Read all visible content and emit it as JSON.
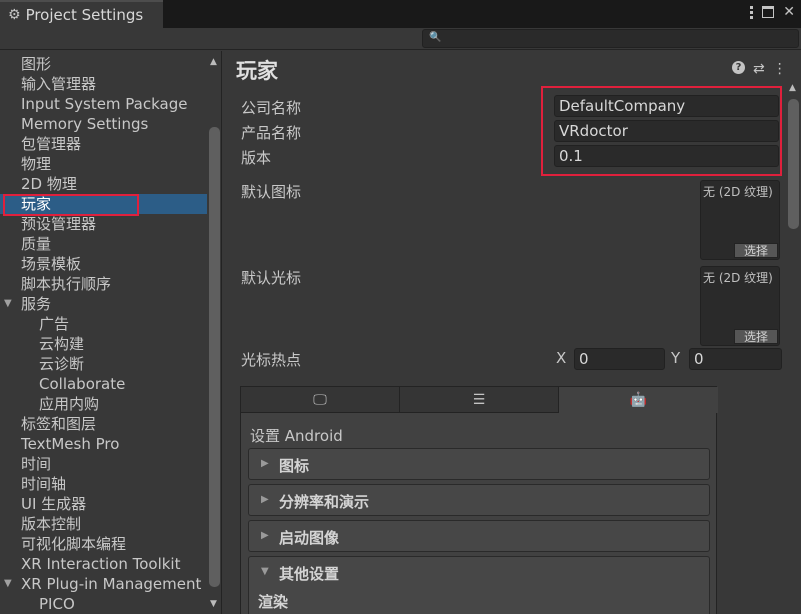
{
  "window": {
    "title": "Project Settings"
  },
  "sidebar": {
    "items": [
      {
        "label": "图形",
        "indent": 0
      },
      {
        "label": "输入管理器",
        "indent": 0
      },
      {
        "label": "Input System Package",
        "indent": 0
      },
      {
        "label": "Memory Settings",
        "indent": 0
      },
      {
        "label": "包管理器",
        "indent": 0
      },
      {
        "label": "物理",
        "indent": 0
      },
      {
        "label": "2D 物理",
        "indent": 0
      },
      {
        "label": "玩家",
        "indent": 0,
        "selected": true
      },
      {
        "label": "预设管理器",
        "indent": 0
      },
      {
        "label": "质量",
        "indent": 0
      },
      {
        "label": "场景模板",
        "indent": 0
      },
      {
        "label": "脚本执行顺序",
        "indent": 0
      },
      {
        "label": "服务",
        "indent": 0,
        "expanded": true
      },
      {
        "label": "广告",
        "indent": 1
      },
      {
        "label": "云构建",
        "indent": 1
      },
      {
        "label": "云诊断",
        "indent": 1
      },
      {
        "label": "Collaborate",
        "indent": 1
      },
      {
        "label": "应用内购",
        "indent": 1
      },
      {
        "label": "标签和图层",
        "indent": 0
      },
      {
        "label": "TextMesh Pro",
        "indent": 0
      },
      {
        "label": "时间",
        "indent": 0
      },
      {
        "label": "时间轴",
        "indent": 0
      },
      {
        "label": "UI 生成器",
        "indent": 0
      },
      {
        "label": "版本控制",
        "indent": 0
      },
      {
        "label": "可视化脚本编程",
        "indent": 0
      },
      {
        "label": "XR Interaction Toolkit",
        "indent": 0
      },
      {
        "label": "XR Plug-in Management",
        "indent": 0,
        "expanded": true
      },
      {
        "label": "PICO",
        "indent": 1
      }
    ]
  },
  "main": {
    "title": "玩家",
    "company": {
      "label": "公司名称",
      "value": "DefaultCompany"
    },
    "product": {
      "label": "产品名称",
      "value": "VRdoctor"
    },
    "version": {
      "label": "版本",
      "value": "0.1"
    },
    "default_icon": {
      "label": "默认图标",
      "none_text": "无 (2D 纹理)",
      "select": "选择"
    },
    "default_cursor": {
      "label": "默认光标",
      "none_text": "无 (2D 纹理)",
      "select": "选择"
    },
    "hotspot": {
      "label": "光标热点",
      "x_label": "X",
      "x_value": "0",
      "y_label": "Y",
      "y_value": "0"
    },
    "platform": {
      "tabs": [
        {
          "icon": "monitor-icon"
        },
        {
          "icon": "server-icon"
        },
        {
          "icon": "android-icon",
          "active": true
        }
      ],
      "title": "设置 Android",
      "sections": [
        {
          "label": "图标",
          "expanded": false
        },
        {
          "label": "分辨率和演示",
          "expanded": false
        },
        {
          "label": "启动图像",
          "expanded": false
        },
        {
          "label": "其他设置",
          "expanded": true
        }
      ],
      "subheading": "渲染"
    }
  },
  "colors": {
    "highlight": "#e0203c",
    "selection": "#2c5d87"
  }
}
